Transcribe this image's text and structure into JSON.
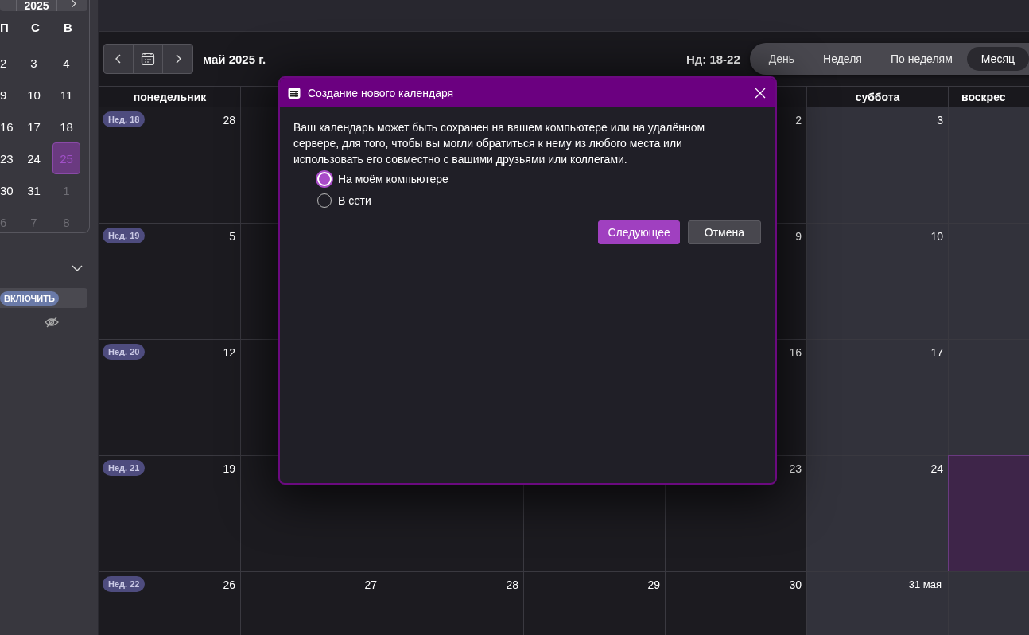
{
  "sidebar": {
    "mini_calendar": {
      "year": "2025",
      "weekdays": [
        "П",
        "С",
        "В"
      ],
      "days": [
        {
          "label": "2",
          "muted": false,
          "selected": false
        },
        {
          "label": "3",
          "muted": false,
          "selected": false
        },
        {
          "label": "4",
          "muted": false,
          "selected": false
        },
        {
          "label": "9",
          "muted": false,
          "selected": false
        },
        {
          "label": "10",
          "muted": false,
          "selected": false
        },
        {
          "label": "11",
          "muted": false,
          "selected": false
        },
        {
          "label": "16",
          "muted": false,
          "selected": false
        },
        {
          "label": "17",
          "muted": false,
          "selected": false
        },
        {
          "label": "18",
          "muted": false,
          "selected": false
        },
        {
          "label": "23",
          "muted": false,
          "selected": false
        },
        {
          "label": "24",
          "muted": false,
          "selected": false
        },
        {
          "label": "25",
          "muted": false,
          "selected": true
        },
        {
          "label": "30",
          "muted": false,
          "selected": false
        },
        {
          "label": "31",
          "muted": false,
          "selected": false
        },
        {
          "label": "1",
          "muted": true,
          "selected": false
        },
        {
          "label": "6",
          "muted": true,
          "selected": false
        },
        {
          "label": "7",
          "muted": true,
          "selected": false
        },
        {
          "label": "8",
          "muted": true,
          "selected": false
        }
      ]
    },
    "enable_button": "ВКЛЮЧИТЬ"
  },
  "toolbar": {
    "month_title": "май 2025 г.",
    "week_range": "Нд: 18-22",
    "views": [
      {
        "label": "День",
        "selected": false
      },
      {
        "label": "Неделя",
        "selected": false
      },
      {
        "label": "По неделям",
        "selected": false
      },
      {
        "label": "Месяц",
        "selected": true
      }
    ]
  },
  "grid": {
    "columns": [
      {
        "label": "понедельник",
        "kind": "weekday"
      },
      {
        "kind": "weekday"
      },
      {
        "kind": "weekday"
      },
      {
        "label": "суббота",
        "kind": "weekend"
      },
      {
        "label": "воскрес",
        "kind": "weekend"
      }
    ],
    "weeks": [
      {
        "label": "Нед. 18",
        "days": [
          {
            "number": "28",
            "today": false
          },
          {
            "today": false
          },
          {
            "number": "2",
            "today": false
          },
          {
            "number": "3",
            "today": false
          },
          {
            "today": false
          }
        ]
      },
      {
        "label": "Нед. 19",
        "days": [
          {
            "number": "5",
            "today": false
          },
          {
            "today": false
          },
          {
            "number": "9",
            "today": false
          },
          {
            "number": "10",
            "today": false
          },
          {
            "today": false
          }
        ]
      },
      {
        "label": "Нед. 20",
        "days": [
          {
            "number": "12",
            "today": false
          },
          {
            "today": false
          },
          {
            "number": "16",
            "today": false
          },
          {
            "number": "17",
            "today": false
          },
          {
            "today": false
          }
        ]
      },
      {
        "label": "Нед. 21",
        "days": [
          {
            "number": "19",
            "today": false
          },
          {
            "today": false
          },
          {
            "today": false
          },
          {
            "today": false
          },
          {
            "number": "23",
            "today": false
          },
          {
            "number": "24",
            "today": false
          },
          {
            "today": true
          }
        ]
      },
      {
        "label": "Нед. 22",
        "days": [
          {
            "number": "26",
            "today": false
          },
          {
            "number": "27",
            "today": false
          },
          {
            "number": "28",
            "today": false
          },
          {
            "number": "29",
            "today": false
          },
          {
            "number": "30",
            "today": false
          },
          {
            "number": "31 мая",
            "today": false
          },
          {
            "today": false
          }
        ]
      }
    ]
  },
  "dialog": {
    "title": "Создание нового календаря",
    "text": "Ваш календарь может быть сохранен на вашем компьютере или на удалённом сервере, для того, чтобы вы могли обратиться к нему из любого места или использовать его совместно с вашими друзьями или коллегами.",
    "options": [
      {
        "label": "На моём компьютере",
        "selected": true
      },
      {
        "label": "В сети",
        "selected": false
      }
    ],
    "buttons": [
      {
        "label": "Следующее",
        "kind": "primary"
      },
      {
        "label": "Отмена",
        "kind": "secondary"
      }
    ]
  }
}
